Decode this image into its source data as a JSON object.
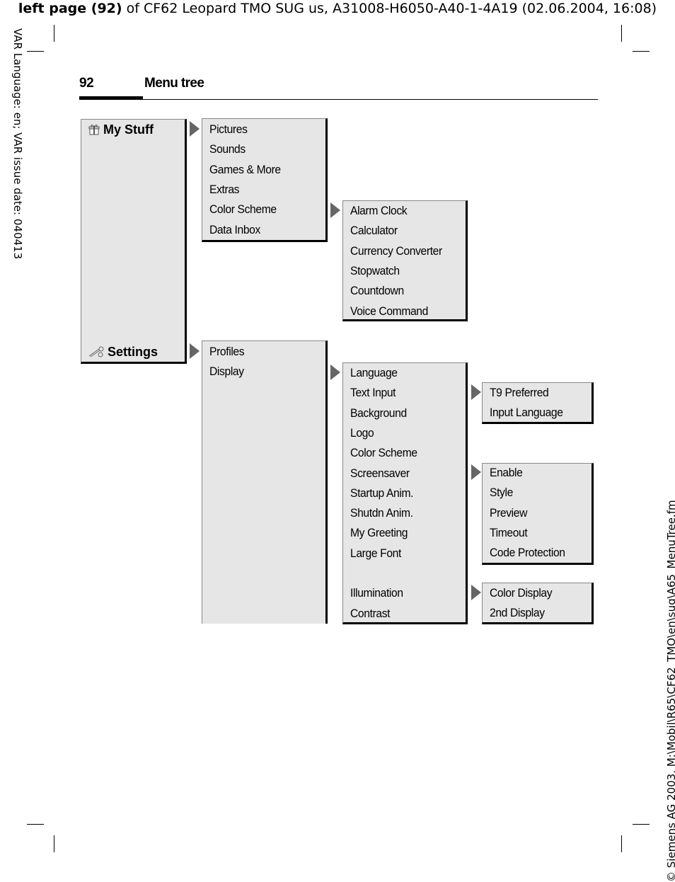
{
  "document": {
    "top_title_bold": "left page (92)",
    "top_title_rest": " of CF62 Leopard TMO SUG us, A31008-H6050-A40-1-4A19 (02.06.2004, 16:08)",
    "left_margin_text": "VAR Language: en; VAR issue date: 040413",
    "right_margin_text": "© Siemens AG 2003, M:\\Mobil\\R65\\CF62_TMO\\en\\sug\\A65_MenuTree.fm",
    "page_number": "92",
    "section_title": "Menu tree"
  },
  "menu_tree": {
    "main": [
      {
        "label": "My Stuff",
        "icon": "gift-icon"
      },
      {
        "label": "Settings",
        "icon": "wrench-icon"
      }
    ],
    "my_stuff": [
      "Pictures",
      "Sounds",
      "Games & More",
      "Extras",
      "Color Scheme",
      "Data Inbox"
    ],
    "extras": [
      "Alarm Clock",
      "Calculator",
      "Currency Converter",
      "Stopwatch",
      "Countdown",
      "Voice Command"
    ],
    "settings": [
      "Profiles",
      "Display"
    ],
    "display": [
      "Language",
      "Text Input",
      "Background",
      "Logo",
      "Color Scheme",
      "Screensaver",
      "Startup Anim.",
      "Shutdn Anim.",
      "My Greeting",
      "Large Font",
      "Illumination",
      "Contrast"
    ],
    "text_input": [
      "T9 Preferred",
      "Input Language"
    ],
    "screensaver": [
      "Enable",
      "Style",
      "Preview",
      "Timeout",
      "Code Protection"
    ],
    "illumination": [
      "Color Display",
      "2nd Display"
    ]
  },
  "colors": {
    "box_fill": "#e6e6e6",
    "arrow": "#666666"
  }
}
